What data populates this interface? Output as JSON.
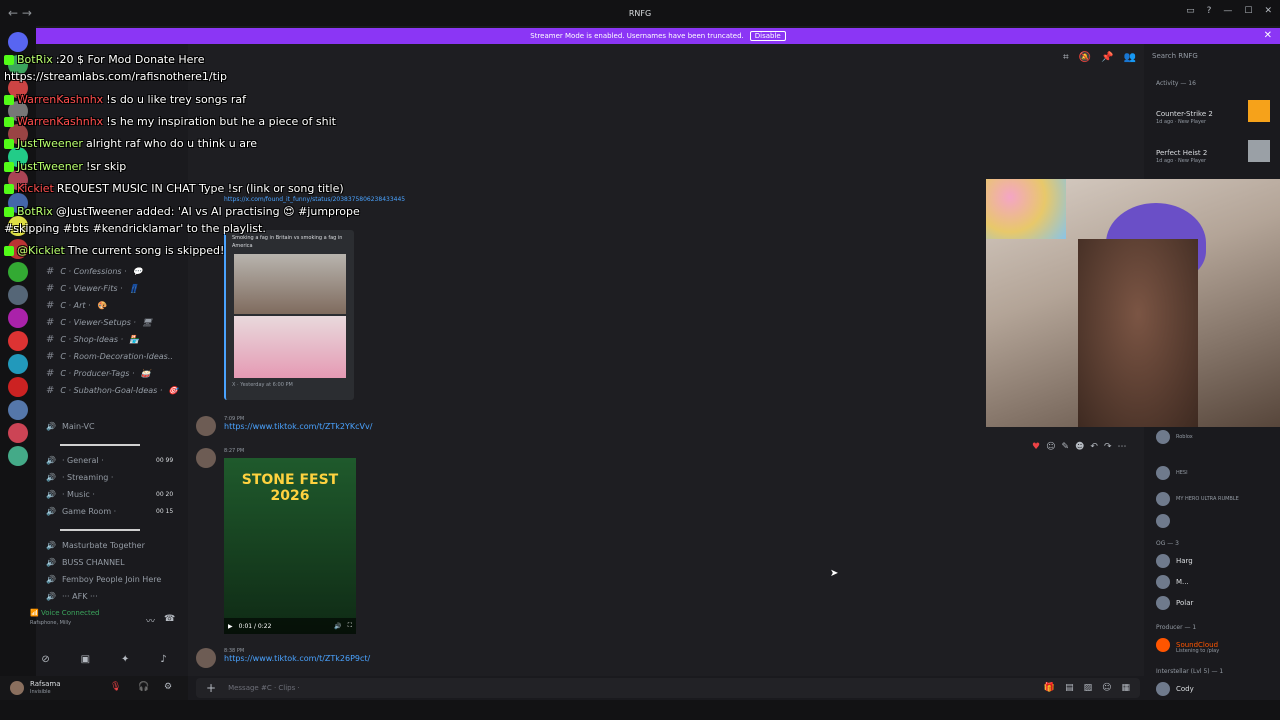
{
  "window": {
    "title": "RNFG"
  },
  "banner": {
    "text": "Streamer Mode is enabled. Usernames have been truncated.",
    "disable_label": "Disable"
  },
  "search": {
    "placeholder": "Search RNFG"
  },
  "chat_overlay": [
    {
      "user": "BotRix",
      "color": "default",
      "text": ":20 $ For Mod Donate Here"
    },
    {
      "user": "",
      "color": "default",
      "text": "https://streamlabs.com/rafisnothere1/tip"
    },
    {
      "user": "WarrenKashnhx",
      "color": "red",
      "text": "!s do u like trey songs raf"
    },
    {
      "user": "WarrenKashnhx",
      "color": "red",
      "text": "!s he my inspiration but he a piece of shit"
    },
    {
      "user": "JustTweener",
      "color": "default",
      "text": "alright raf who do u think u are"
    },
    {
      "user": "JustTweener",
      "color": "default",
      "text": "!sr skip"
    },
    {
      "user": "Kickiet",
      "color": "red",
      "text": "REQUEST MUSIC IN CHAT Type !sr (link or song title)"
    },
    {
      "user": "BotRix",
      "color": "default",
      "text": "@JustTweener added: 'AI vs AI practising 😍 #jumprope"
    },
    {
      "user": "",
      "color": "default",
      "text": "#skipping #bts #kendricklamar' to the playlist."
    },
    {
      "user": "@Kickiet",
      "color": "default",
      "text": "The current song is skipped!"
    }
  ],
  "sidebar": {
    "channels": [
      {
        "label": "C · Confessions ·",
        "emoji": "💬"
      },
      {
        "label": "C · Viewer-Fits ·",
        "emoji": "👖"
      },
      {
        "label": "C · Art ·",
        "emoji": "🎨"
      },
      {
        "label": "C · Viewer-Setups ·",
        "emoji": "🖥"
      },
      {
        "label": "C · Shop-Ideas ·",
        "emoji": "🏪"
      },
      {
        "label": "C · Room-Decoration-Ideas..",
        "emoji": ""
      },
      {
        "label": "C · Producer-Tags ·",
        "emoji": "🥁"
      },
      {
        "label": "C · Subathon-Goal-Ideas ·",
        "emoji": "🎯"
      }
    ],
    "voice_channels": [
      {
        "label": "Main-VC",
        "nums": ""
      },
      {
        "label": "· General ·",
        "nums": "00  99"
      },
      {
        "label": "· Streaming ·",
        "nums": ""
      },
      {
        "label": "· Music ·",
        "nums": "00  20"
      },
      {
        "label": "Game Room ·",
        "nums": "00  15"
      },
      {
        "label": "Masturbate Together",
        "nums": ""
      },
      {
        "label": "BUSS CHANNEL",
        "nums": ""
      },
      {
        "label": "Femboy People Join Here",
        "nums": ""
      },
      {
        "label": "··· AFK ···",
        "nums": ""
      }
    ],
    "voice_status": {
      "title": "Voice Connected",
      "sub": "Rafsphone, Milly"
    },
    "user": {
      "name": "Rafsama",
      "status": "Invisible"
    }
  },
  "messages": [
    {
      "link": "https://x.com/found_it_funny/status/2038375806238433445",
      "embed_caption": "Smoking a fag in Britain vs smoking a fag in America",
      "embed_footer": "X · Yesterday at 6:00 PM"
    },
    {
      "time": "7:09 PM",
      "link": "https://www.tiktok.com/t/ZTk2YKcVv/"
    },
    {
      "time": "8:27 PM",
      "video_time": "0:01 / 0:22",
      "poster_title": "STONE FEST 2026"
    },
    {
      "time": "8:38 PM",
      "link": "https://www.tiktok.com/t/ZTk26P9ct/"
    }
  ],
  "composer": {
    "placeholder": "Message #C · Clips ·"
  },
  "right_panel": {
    "activity_label": "Activity — 16",
    "activities": [
      {
        "game": "Counter-Strike 2",
        "sub": "1d ago · New Player"
      },
      {
        "game": "Perfect Heist 2",
        "sub": "1d ago · New Player"
      }
    ],
    "members_top": [
      {
        "name": "",
        "sub": "Roblox"
      },
      {
        "name": "",
        "sub": "HESI"
      },
      {
        "name": "",
        "sub": "MY HERO ULTRA RUMBLE"
      },
      {
        "name": "",
        "sub": ""
      }
    ],
    "og_label": "OG — 3",
    "og_members": [
      "Harg",
      "M...",
      "Polar"
    ],
    "producer_label": "Producer — 1",
    "producer_member": {
      "name": "SoundCloud",
      "sub": "Listening to /play"
    },
    "interstellar_label": "Interstellar (Lvl 5) — 1",
    "interstellar_member": "Cody"
  },
  "colors": {
    "accent": "#8b36f5",
    "link": "#4aa3ff",
    "bg": "#1e1e22"
  }
}
